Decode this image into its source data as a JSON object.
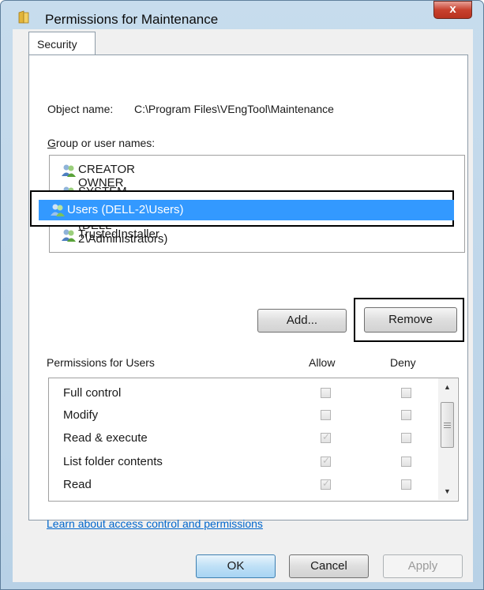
{
  "window": {
    "title": "Permissions for Maintenance",
    "close_label": "x"
  },
  "tabs": [
    {
      "label": "Security"
    }
  ],
  "object": {
    "label": "Object name:",
    "value": "C:\\Program Files\\VEngTool\\Maintenance"
  },
  "groups": {
    "label": "Group or user names:",
    "items": [
      {
        "name": "CREATOR OWNER"
      },
      {
        "name": "SYSTEM"
      },
      {
        "name": "Administrators (DELL-2\\Administrators)"
      },
      {
        "name": "Users (DELL-2\\Users)",
        "selected": true
      },
      {
        "name": "TrustedInstaller"
      }
    ]
  },
  "buttons": {
    "add": "Add...",
    "remove": "Remove",
    "ok": "OK",
    "cancel": "Cancel",
    "apply": "Apply"
  },
  "permissions": {
    "title": "Permissions for Users",
    "allow_header": "Allow",
    "deny_header": "Deny",
    "rows": [
      {
        "name": "Full control",
        "allow": false,
        "deny": false
      },
      {
        "name": "Modify",
        "allow": false,
        "deny": false
      },
      {
        "name": "Read & execute",
        "allow": true,
        "deny": false
      },
      {
        "name": "List folder contents",
        "allow": true,
        "deny": false
      },
      {
        "name": "Read",
        "allow": true,
        "deny": false
      }
    ]
  },
  "help_link": "Learn about access control and permissions",
  "colors": {
    "selection": "#3399ff",
    "link": "#0066cc",
    "close_button": "#c8412e"
  },
  "icons": {
    "title": "folder-icon",
    "group": "user-group-icon"
  }
}
